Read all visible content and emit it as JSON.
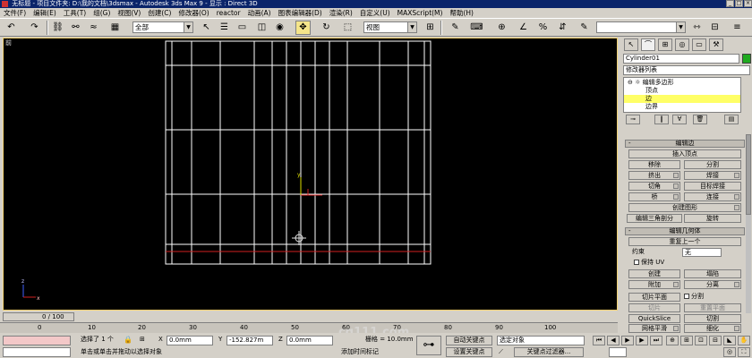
{
  "titlebar": {
    "text": "无标题    - 项目文件夹: D:\\我的文档\\3dsmax    - Autodesk 3ds Max 9    - 显示 : Direct 3D",
    "min": "_",
    "max": "□",
    "close": "×"
  },
  "menu": [
    "文件(F)",
    "编辑(E)",
    "工具(T)",
    "组(G)",
    "视图(V)",
    "创建(C)",
    "修改器(O)",
    "reactor",
    "动画(A)",
    "图表编辑器(D)",
    "渲染(R)",
    "自定义(U)",
    "MAXScript(M)",
    "帮助(H)"
  ],
  "toolbar": {
    "selection_filter": "全部",
    "ref_coord": "视图"
  },
  "viewport": {
    "label": "前",
    "axis_y": "y",
    "axis_x": "x",
    "axis_z": "z"
  },
  "time": {
    "slider_label": "0 / 100",
    "ruler_ticks": [
      "0",
      "10",
      "20",
      "30",
      "40",
      "50",
      "60",
      "70",
      "80",
      "90",
      "100"
    ]
  },
  "status": {
    "selected": "选择了 1 个",
    "x_label": "X",
    "x_value": "0.0mm",
    "y_label": "Y",
    "y_value": "-152.827m",
    "z_label": "Z",
    "z_value": "0.0mm",
    "grid": "栅格 = 10.0mm",
    "prompt": "单击或单击并拖动以选择对象",
    "add_time_tag": "添加时间标记",
    "auto_key": "自动关键点",
    "set_key": "设置关键点",
    "key_mode": "选定对象",
    "key_filters": "关键点过滤器..."
  },
  "panel": {
    "object_name": "Cylinder01",
    "object_color": "#1faa1f",
    "modifier_list": "修改器列表",
    "stack": [
      "编辑多边形",
      "顶点",
      "边",
      "边界"
    ],
    "rollout_edit_edges": "编辑边",
    "insert_vertex": "插入顶点",
    "remove": "移除",
    "split": "分割",
    "extrude": "挤出",
    "weld": "焊接",
    "chamfer": "切角",
    "target_weld": "目标焊接",
    "bridge": "桥",
    "connect": "连接",
    "create_shape": "创建图形",
    "edit_tri": "编辑三角剖分",
    "turn": "旋转",
    "rollout_edit_geometry": "编辑几何体",
    "repeat_last": "重复上一个",
    "constraints_label": "约束",
    "constraints_value": "无",
    "preserve_uvs": "保持 UV",
    "create": "创建",
    "collapse": "塌陷",
    "attach": "附加",
    "detach": "分离",
    "slice_plane": "切片平面",
    "split_chk": "分割",
    "slice": "切片",
    "reset_plane": "重置平面",
    "quickslice": "QuickSlice",
    "cut": "切割",
    "meshsmooth": "网格平滑",
    "tessellate": "细化"
  },
  "watermark": "cg111.com"
}
